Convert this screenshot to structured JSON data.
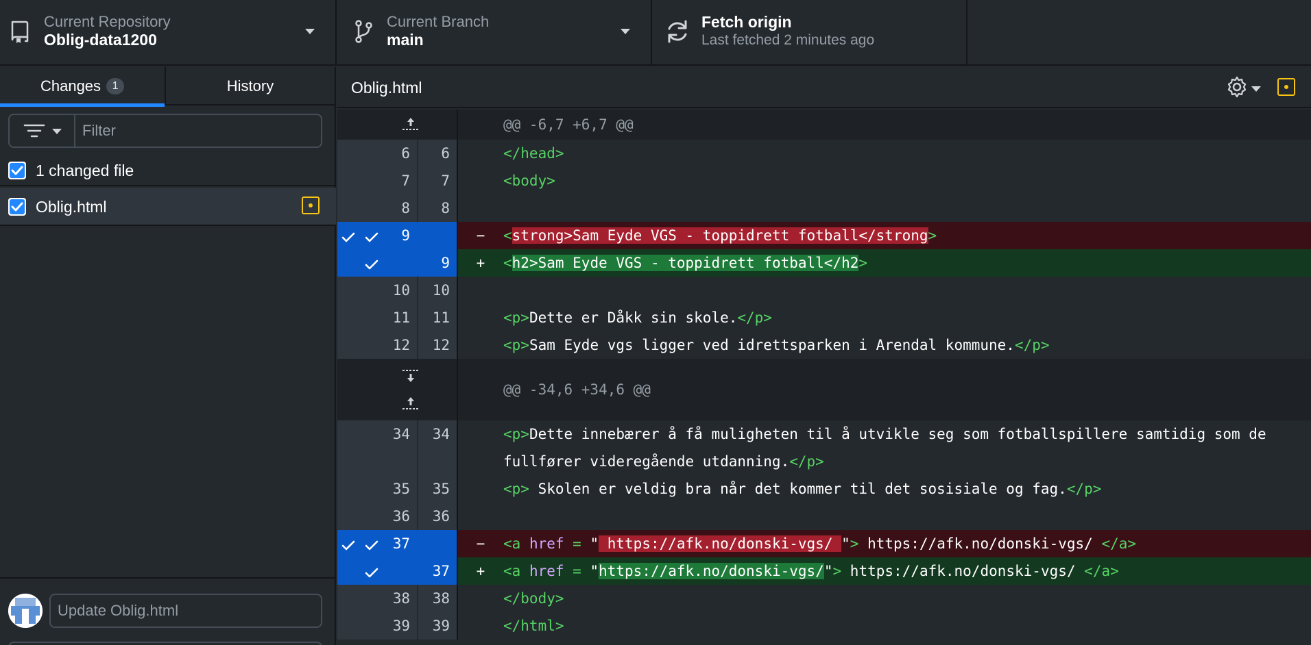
{
  "toolbar": {
    "repo": {
      "sub": "Current Repository",
      "name": "Oblig-data1200"
    },
    "branch": {
      "sub": "Current Branch",
      "name": "main"
    },
    "fetch": {
      "title": "Fetch origin",
      "sub": "Last fetched 2 minutes ago"
    }
  },
  "sidebar": {
    "tabs": [
      {
        "label": "Changes",
        "badge": "1"
      },
      {
        "label": "History"
      }
    ],
    "filter": {
      "placeholder": "Filter"
    },
    "changed_label": "1 changed file",
    "files": [
      {
        "name": "Oblig.html",
        "status": "modified"
      }
    ],
    "commit": {
      "summary_placeholder": "Update Oblig.html"
    }
  },
  "diff": {
    "file_name": "Oblig.html",
    "hunks": [
      {
        "header": "@@ -6,7 +6,7 @@"
      },
      {
        "header": "@@ -34,6 +34,6 @@"
      }
    ],
    "lines": [
      {
        "old": "6",
        "new": "6",
        "segs": [
          [
            "tag",
            "</head>"
          ]
        ]
      },
      {
        "old": "7",
        "new": "7",
        "segs": [
          [
            "tag",
            "<body>"
          ]
        ]
      },
      {
        "old": "8",
        "new": "8",
        "segs": []
      },
      {
        "old": "9",
        "new": "",
        "type": "del",
        "marker": "−",
        "segs": [
          [
            "tag",
            "<"
          ],
          [
            "hl",
            "strong>Sam Eyde VGS - toppidrett fotball</strong"
          ],
          [
            "tag",
            ">"
          ]
        ]
      },
      {
        "old": "",
        "new": "9",
        "type": "add",
        "marker": "+",
        "segs": [
          [
            "tag",
            "<"
          ],
          [
            "hl",
            "h2>Sam Eyde VGS - toppidrett fotball</h2"
          ],
          [
            "tag",
            ">"
          ]
        ]
      },
      {
        "old": "10",
        "new": "10",
        "segs": []
      },
      {
        "old": "11",
        "new": "11",
        "segs": [
          [
            "tag",
            "<p>"
          ],
          [
            "text",
            "Dette er Dåkk sin skole."
          ],
          [
            "tag",
            "</p>"
          ]
        ]
      },
      {
        "old": "12",
        "new": "12",
        "segs": [
          [
            "tag",
            "<p>"
          ],
          [
            "text",
            "Sam Eyde vgs ligger ved idrettsparken i Arendal kommune."
          ],
          [
            "tag",
            "</p>"
          ]
        ]
      },
      {
        "old": "34",
        "new": "34",
        "segs": [
          [
            "tag",
            "<p>"
          ],
          [
            "text",
            "Dette innebærer å få muligheten til å utvikle seg som fotballspillere samtidig som de fullfører videregående utdanning."
          ],
          [
            "tag",
            "</p>"
          ]
        ]
      },
      {
        "old": "35",
        "new": "35",
        "segs": [
          [
            "tag",
            "<p>"
          ],
          [
            "text",
            " Skolen er veldig bra når det kommer til det sosisiale og fag."
          ],
          [
            "tag",
            "</p>"
          ]
        ]
      },
      {
        "old": "36",
        "new": "36",
        "segs": []
      },
      {
        "old": "37",
        "new": "",
        "type": "del",
        "marker": "−",
        "segs": [
          [
            "tag",
            "<a "
          ],
          [
            "attr",
            "href"
          ],
          [
            "tag",
            " = "
          ],
          [
            "text",
            "\""
          ],
          [
            "hl",
            " https://afk.no/donski-vgs/ "
          ],
          [
            "text",
            "\""
          ],
          [
            "tag",
            ">"
          ],
          [
            "text",
            " https://afk.no/donski-vgs/ "
          ],
          [
            "tag",
            "</a>"
          ]
        ]
      },
      {
        "old": "",
        "new": "37",
        "type": "add",
        "marker": "+",
        "segs": [
          [
            "tag",
            "<a "
          ],
          [
            "attr",
            "href"
          ],
          [
            "tag",
            " = "
          ],
          [
            "text",
            "\""
          ],
          [
            "hl",
            "https://afk.no/donski-vgs/"
          ],
          [
            "text",
            "\""
          ],
          [
            "tag",
            ">"
          ],
          [
            "text",
            " https://afk.no/donski-vgs/ "
          ],
          [
            "tag",
            "</a>"
          ]
        ]
      },
      {
        "old": "38",
        "new": "38",
        "segs": [
          [
            "tag",
            "</body>"
          ]
        ]
      },
      {
        "old": "39",
        "new": "39",
        "segs": [
          [
            "tag",
            "</html>"
          ]
        ]
      }
    ]
  },
  "colors": {
    "accent": "#2188ff",
    "modified": "#f9c513",
    "deleted_bg": "#3a1016",
    "added_bg": "#133a20"
  }
}
